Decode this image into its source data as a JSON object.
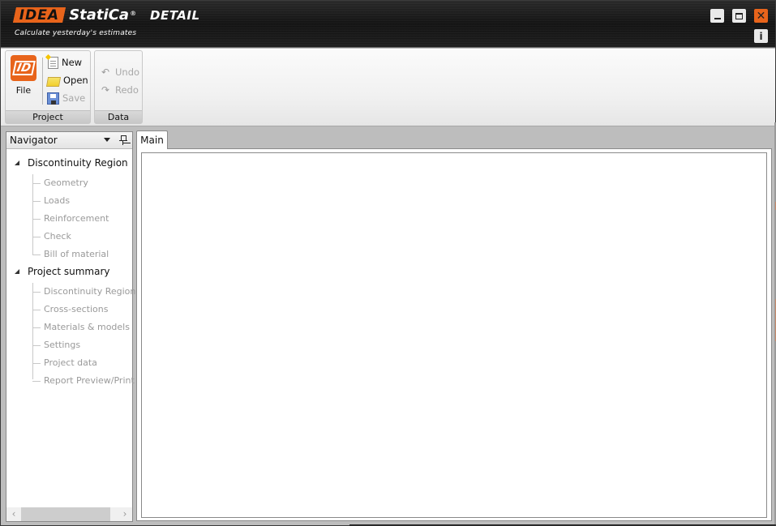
{
  "titlebar": {
    "logo_idea": "IDEA",
    "logo_statica": "StatiCa",
    "logo_reg": "®",
    "app_name": "DETAIL",
    "tagline": "Calculate yesterday's estimates",
    "buttons": {
      "minimize": "minimize-icon",
      "maximize": "maximize-icon",
      "close": "close-icon",
      "info": "info-icon"
    },
    "close_glyph": "✕",
    "info_glyph": "i",
    "accent_color": "#e8641b"
  },
  "ribbon": {
    "groups": [
      {
        "label": "Project",
        "file": {
          "label": "File",
          "icon": "ID"
        },
        "items": [
          {
            "label": "New",
            "icon": "new-document-icon",
            "enabled": true
          },
          {
            "label": "Open",
            "icon": "open-folder-icon",
            "enabled": true
          },
          {
            "label": "Save",
            "icon": "save-disk-icon",
            "enabled": false
          }
        ]
      },
      {
        "label": "Data",
        "items": [
          {
            "label": "Undo",
            "icon": "undo-icon",
            "glyph": "↶",
            "enabled": false
          },
          {
            "label": "Redo",
            "icon": "redo-icon",
            "glyph": "↷",
            "enabled": false
          }
        ]
      }
    ]
  },
  "navigator": {
    "title": "Navigator",
    "tree": [
      {
        "label": "Discontinuity Region",
        "expanded": true,
        "children": [
          "Geometry",
          "Loads",
          "Reinforcement",
          "Check",
          "Bill of material"
        ]
      },
      {
        "label": "Project summary",
        "expanded": true,
        "children": [
          "Discontinuity Region",
          "Cross-sections",
          "Materials & models",
          "Settings",
          "Project data",
          "Report Preview/Print"
        ]
      }
    ],
    "scroll_left": "‹",
    "scroll_right": "›"
  },
  "document": {
    "tabs": [
      {
        "label": "Main",
        "active": true
      }
    ]
  }
}
